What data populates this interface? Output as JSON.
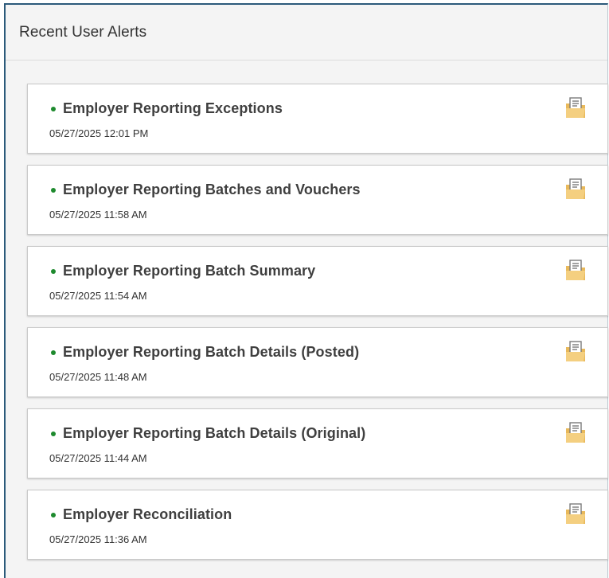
{
  "panel": {
    "title": "Recent User Alerts"
  },
  "alerts": [
    {
      "title": "Employer Reporting Exceptions",
      "timestamp": "05/27/2025 12:01 PM",
      "icon": "report-document-icon"
    },
    {
      "title": "Employer Reporting Batches and Vouchers",
      "timestamp": "05/27/2025 11:58 AM",
      "icon": "report-document-icon"
    },
    {
      "title": "Employer Reporting Batch Summary",
      "timestamp": "05/27/2025 11:54 AM",
      "icon": "report-document-icon"
    },
    {
      "title": "Employer Reporting Batch Details (Posted)",
      "timestamp": "05/27/2025 11:48 AM",
      "icon": "report-document-icon"
    },
    {
      "title": "Employer Reporting Batch Details (Original)",
      "timestamp": "05/27/2025 11:44 AM",
      "icon": "report-document-icon"
    },
    {
      "title": "Employer Reconciliation",
      "timestamp": "05/27/2025 11:36 AM",
      "icon": "report-document-icon"
    }
  ],
  "colors": {
    "panel_border": "#2b5a7a",
    "bullet": "#1e8a2e",
    "icon_folder": "#f2c66f"
  }
}
